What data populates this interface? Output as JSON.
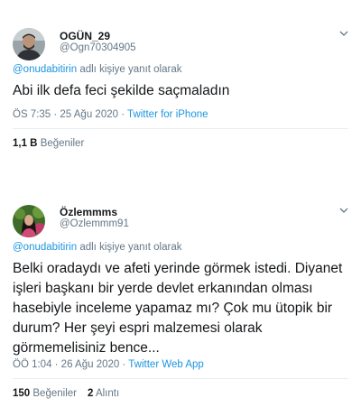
{
  "tweets": [
    {
      "name": "OGÜN_29",
      "handle": "@Ogn70304905",
      "reply_mention": "@onudabitirin",
      "reply_suffix": " adlı kişiye yanıt olarak",
      "text": "Abi ilk defa feci şekilde saçmaladın",
      "timestamp": "ÖS 7:35 · 25 Ağu 2020 · ",
      "source": "Twitter for iPhone",
      "likes_count": "1,1 B",
      "likes_label": " Beğeniler",
      "menu_icon": "chevron-down-icon"
    },
    {
      "name": "Özlemmms",
      "handle": "@Ozlemmm91",
      "reply_mention": "@onudabitirin",
      "reply_suffix": " adlı kişiye yanıt olarak",
      "text": "Belki oradaydı ve afeti yerinde görmek istedi. Diyanet işleri başkanı bir yerde devlet erkanından olması hasebiyle inceleme yapamaz mı? Çok mu ütopik bir durum? Her şeyi espri malzemesi olarak görmemelisiniz bence...",
      "timestamp": "ÖÖ 1:04 · 26 Ağu 2020 · ",
      "source": "Twitter Web App",
      "likes_count": "150",
      "likes_label": " Beğeniler",
      "quotes_count": "2",
      "quotes_label": " Alıntı",
      "menu_icon": "chevron-down-icon"
    }
  ],
  "colors": {
    "text": "#14171a",
    "secondary": "#657786",
    "link": "#1b95e0",
    "divider": "#e6ecf0"
  }
}
